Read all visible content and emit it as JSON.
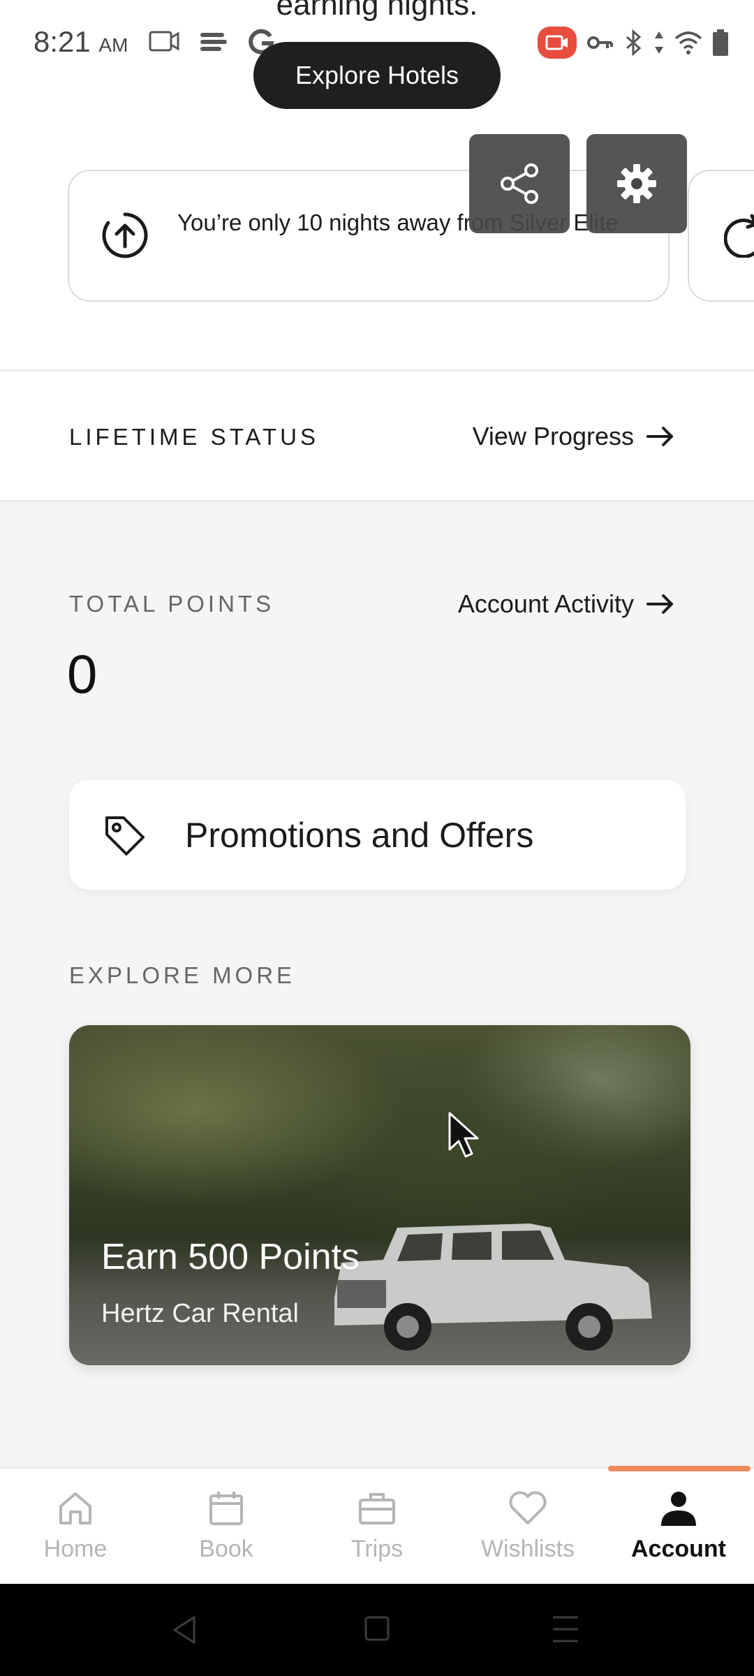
{
  "top": {
    "cut_text": "earning nights.",
    "explore_button": "Explore Hotels"
  },
  "statusbar": {
    "time": "8:21",
    "ampm": "AM"
  },
  "progress_card": {
    "text": "You’re only 10 nights away from Silver Elite"
  },
  "lifetime": {
    "label": "LIFETIME STATUS",
    "link": "View Progress"
  },
  "points": {
    "label": "TOTAL POINTS",
    "value": "0",
    "link": "Account Activity"
  },
  "promotions": {
    "label": "Promotions and Offers"
  },
  "explore_more": {
    "label": "EXPLORE MORE",
    "card_title": "Earn 500 Points",
    "card_subtitle": "Hertz Car Rental"
  },
  "nav": {
    "items": [
      {
        "label": "Home",
        "icon": "home-icon"
      },
      {
        "label": "Book",
        "icon": "calendar-icon"
      },
      {
        "label": "Trips",
        "icon": "briefcase-icon"
      },
      {
        "label": "Wishlists",
        "icon": "heart-icon"
      },
      {
        "label": "Account",
        "icon": "person-icon",
        "active": true
      }
    ]
  },
  "colors": {
    "accent": "#f08a5d",
    "pill_bg": "#1f1f1f",
    "recording_badge": "#e74c3c"
  }
}
